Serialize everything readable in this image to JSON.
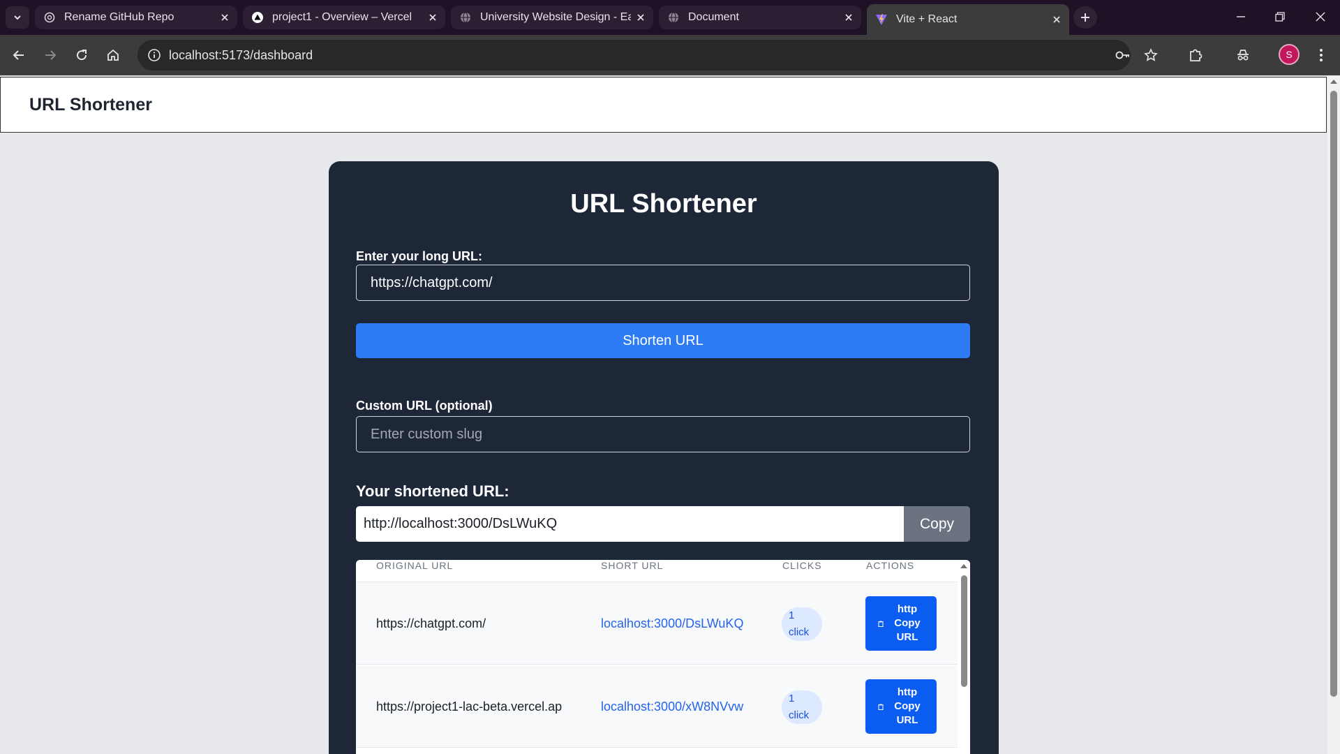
{
  "browser": {
    "tabs": [
      {
        "title": "Rename GitHub Repo",
        "icon": "openai-icon"
      },
      {
        "title": "project1 - Overview – Vercel",
        "icon": "vercel-icon"
      },
      {
        "title": "University Website Design - Eas",
        "icon": "globe-icon"
      },
      {
        "title": "Document",
        "icon": "globe-icon"
      },
      {
        "title": "Vite + React",
        "icon": "vite-icon",
        "active": true
      }
    ],
    "url": "localhost:5173/dashboard",
    "profile_initial": "S"
  },
  "header": {
    "title": "URL Shortener"
  },
  "card": {
    "title": "URL Shortener",
    "long_url_label": "Enter your long URL:",
    "long_url_value": "https://chatgpt.com/",
    "shorten_button": "Shorten URL",
    "custom_label": "Custom URL (optional)",
    "custom_placeholder": "Enter custom slug",
    "result_title": "Your shortened URL:",
    "result_value": "http://localhost:3000/DsLWuKQ",
    "copy_button": "Copy"
  },
  "table": {
    "headers": [
      "ORIGINAL URL",
      "SHORT URL",
      "CLICKS",
      "ACTIONS"
    ],
    "rows": [
      {
        "original": "https://chatgpt.com/",
        "short": "localhost:3000/DsLWuKQ",
        "clicks_count": "1",
        "clicks_unit": "click",
        "action_line1": "http",
        "action_line2": "Copy",
        "action_line3": "URL"
      },
      {
        "original": "https://project1-lac-beta.vercel.ap",
        "short": "localhost:3000/xW8NVvw",
        "clicks_count": "1",
        "clicks_unit": "click",
        "action_line1": "http",
        "action_line2": "Copy",
        "action_line3": "URL"
      }
    ]
  },
  "colors": {
    "card_bg": "#1e2738",
    "primary_button": "#2d7cf6",
    "action_button": "#0b5cf0",
    "link": "#2563eb",
    "page_bg": "#e6e8ec"
  }
}
